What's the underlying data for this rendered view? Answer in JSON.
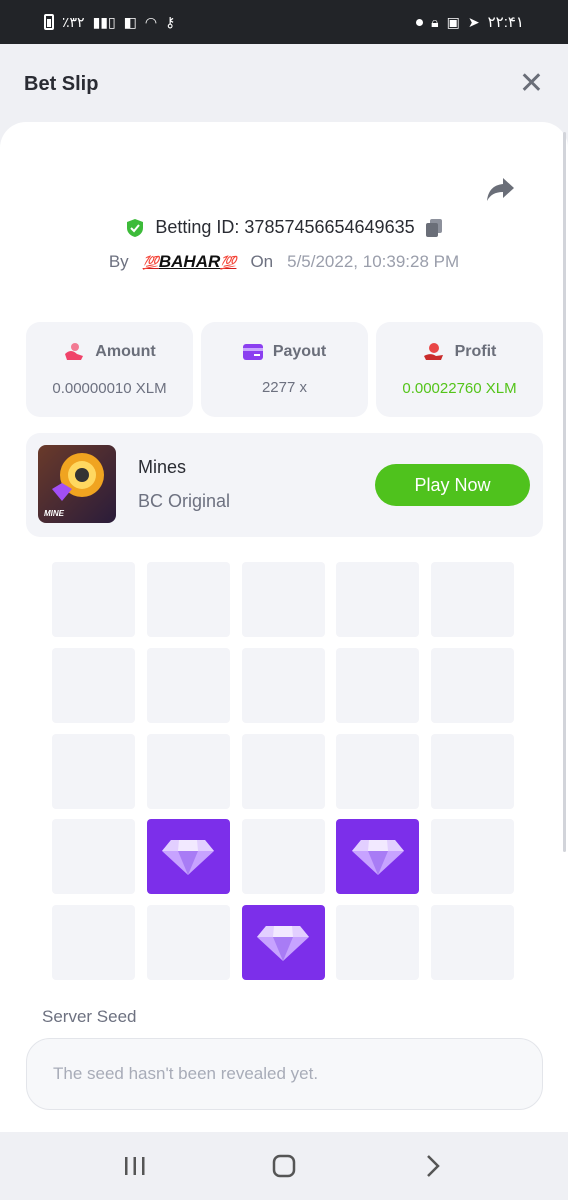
{
  "status_bar": {
    "left_text": "٪۳۲",
    "right_time": "۲۲:۴۱"
  },
  "header": {
    "title": "Bet Slip",
    "close_label": "✕"
  },
  "bet": {
    "betting_id_label": "Betting ID: 37857456654649635",
    "by_label": "By",
    "username_prefix": "💯",
    "username": "BAHAR",
    "username_suffix": "💯",
    "on_label": "On",
    "datetime": "5/5/2022, 10:39:28 PM"
  },
  "stats": [
    {
      "label": "Amount",
      "value": "0.00000010 XLM",
      "icon": "amount-icon"
    },
    {
      "label": "Payout",
      "value": "2277 x",
      "icon": "card-icon"
    },
    {
      "label": "Profit",
      "value": "0.00022760 XLM",
      "icon": "profit-hand-icon"
    }
  ],
  "game": {
    "name": "Mines",
    "subtitle": "BC Original",
    "thumb_label": "MINE",
    "play_label": "Play Now"
  },
  "grid": {
    "rows": 5,
    "cols": 5,
    "gems": [
      [
        3,
        1
      ],
      [
        3,
        3
      ],
      [
        4,
        2
      ]
    ]
  },
  "seed": {
    "label": "Server Seed",
    "value": "The seed hasn't been revealed yet."
  },
  "colors": {
    "accent_green": "#4fc21d",
    "profit_green": "#54c41a",
    "gem_purple": "#7c2fea"
  }
}
